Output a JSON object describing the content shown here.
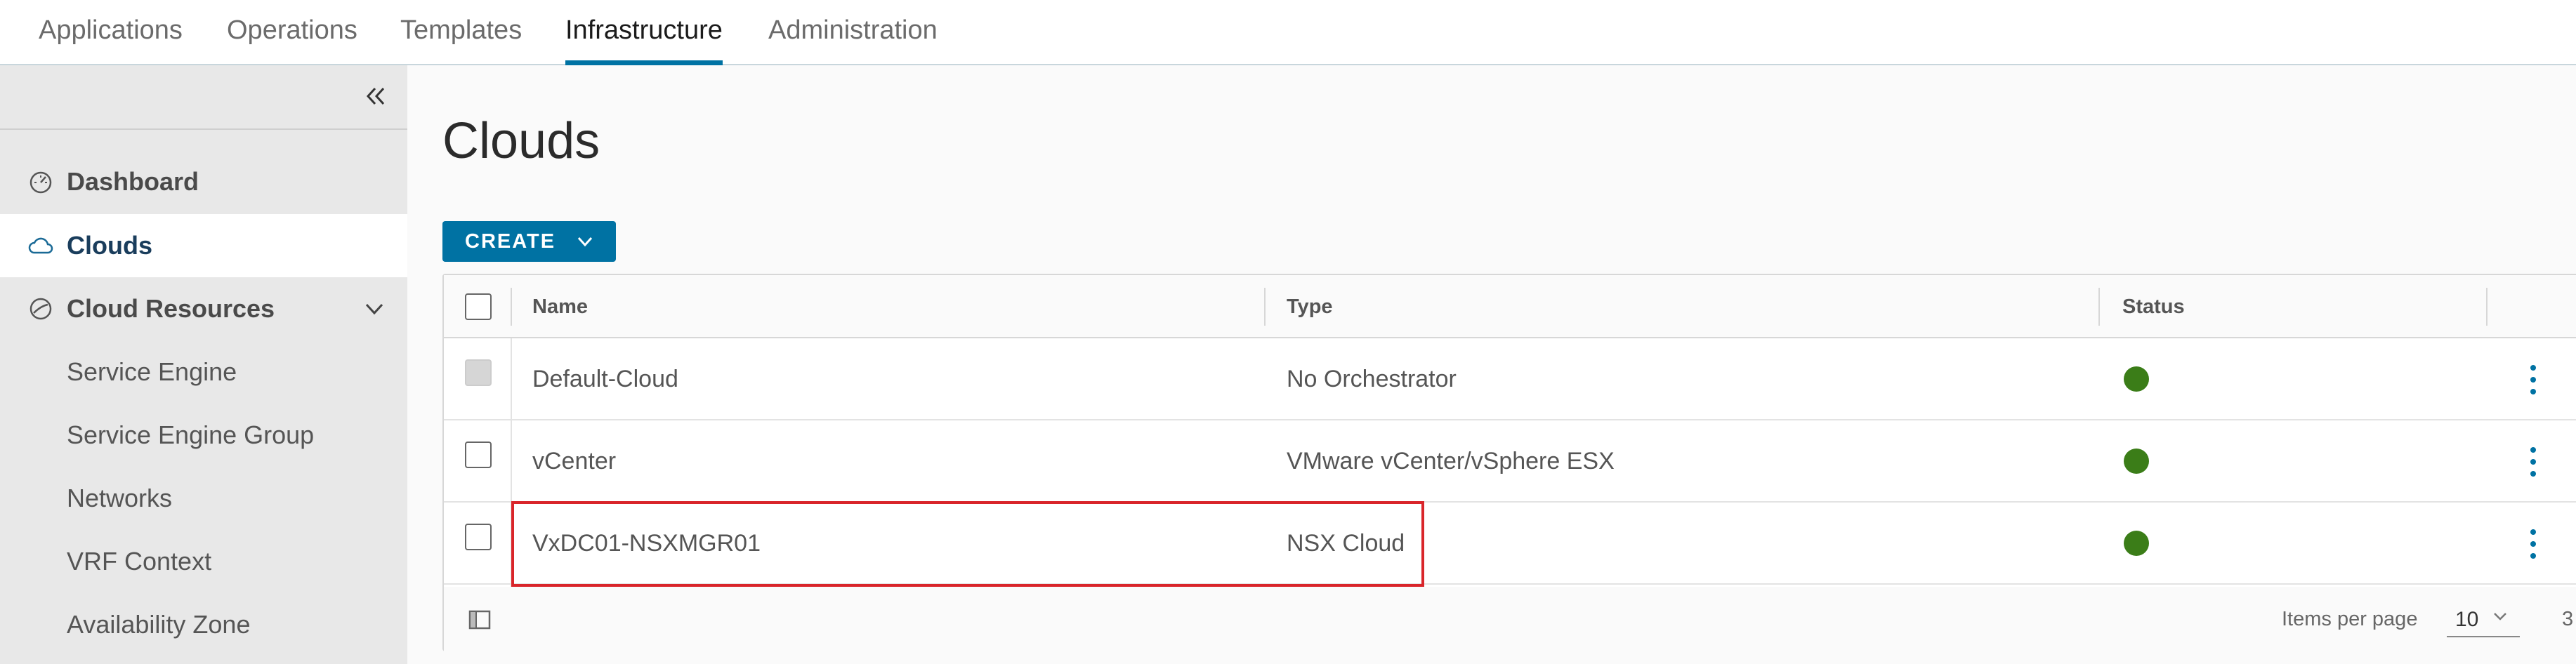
{
  "topnav": {
    "tabs": [
      {
        "label": "Applications"
      },
      {
        "label": "Operations"
      },
      {
        "label": "Templates"
      },
      {
        "label": "Infrastructure",
        "active": true
      },
      {
        "label": "Administration"
      }
    ]
  },
  "sidebar": {
    "collapse_icon": "double-chevron-left-icon",
    "items": [
      {
        "label": "Dashboard",
        "icon": "dashboard-icon"
      },
      {
        "label": "Clouds",
        "icon": "cloud-icon",
        "selected": true
      },
      {
        "label": "Cloud Resources",
        "icon": "cloud-resources-icon",
        "expanded": true
      }
    ],
    "subitems": [
      {
        "label": "Service Engine"
      },
      {
        "label": "Service Engine Group"
      },
      {
        "label": "Networks"
      },
      {
        "label": "VRF Context"
      },
      {
        "label": "Availability Zone"
      }
    ]
  },
  "main": {
    "title": "Clouds",
    "create_label": "CREATE",
    "table": {
      "columns": [
        "Name",
        "Type",
        "Status"
      ],
      "rows": [
        {
          "name": "Default-Cloud",
          "type": "No Orchestrator",
          "status": "green",
          "checkbox_disabled": true
        },
        {
          "name": "vCenter",
          "type": "VMware vCenter/vSphere ESX",
          "status": "green",
          "checkbox_disabled": false
        },
        {
          "name": "VxDC01-NSXMGR01",
          "type": "NSX Cloud",
          "status": "green",
          "checkbox_disabled": false
        }
      ],
      "footer": {
        "items_per_page_label": "Items per page",
        "items_per_page_value": "10",
        "count": "3"
      }
    }
  },
  "colors": {
    "accent": "#0072a3",
    "status_green": "#3b7d18",
    "highlight_red": "#d9252a"
  }
}
